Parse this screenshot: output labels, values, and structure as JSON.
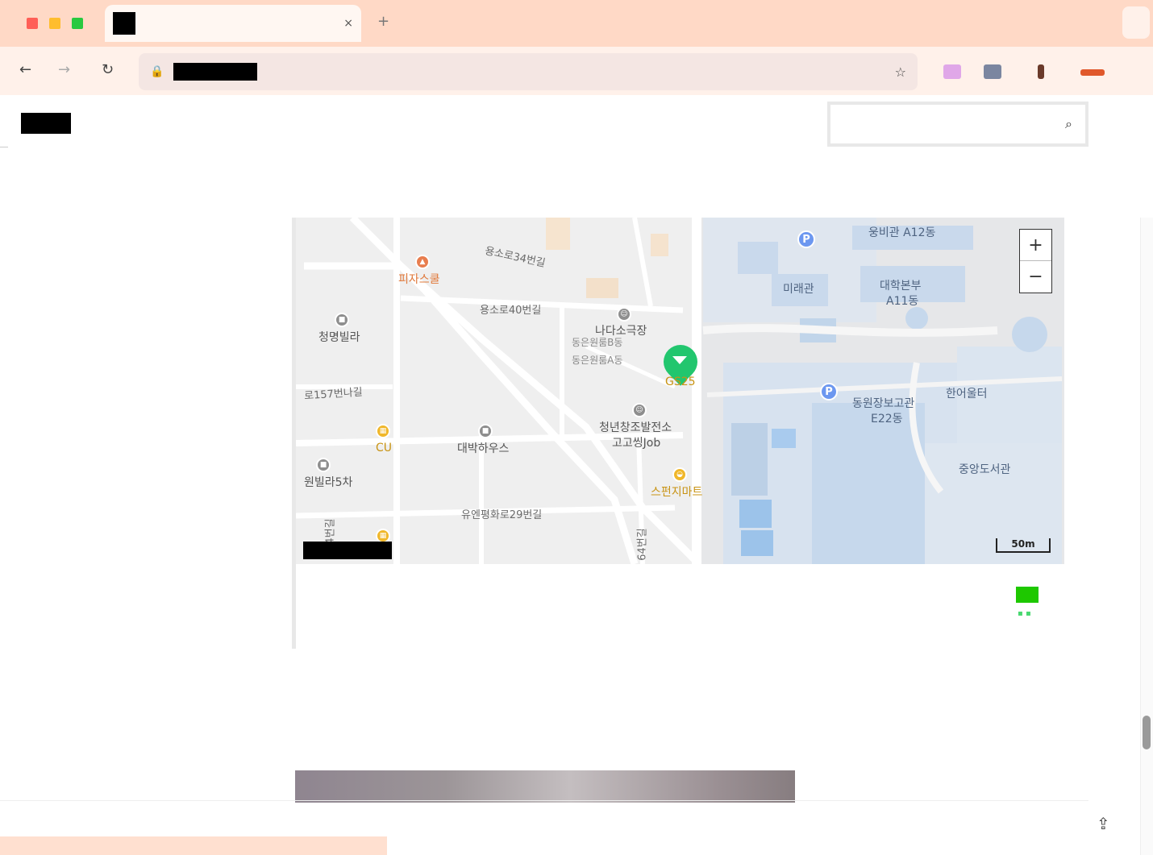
{
  "browser": {
    "tab_title": "",
    "tab_close": "×",
    "new_tab": "+",
    "url": "",
    "colors": {
      "tabbar_bg": "#ffd9c6",
      "toolbar_bg": "#fff1ea",
      "red": "#ff5f57",
      "yellow": "#ffbd2e",
      "green": "#28c940"
    }
  },
  "page": {
    "site_title": "",
    "search_placeholder": "",
    "section_label": "",
    "source_label": "",
    "source_link": "",
    "bottom_text": "",
    "status_text": ""
  },
  "map": {
    "zoom_in": "+",
    "zoom_out": "−",
    "scale": "50m",
    "roads": {
      "r1": "용소로34번길",
      "r2": "용소로40번길",
      "r3": "로157번나길",
      "r4": "유엔평화로29번길",
      "r5": "4번길",
      "r6": "64번길"
    },
    "pois": {
      "pizza": "피자스쿨",
      "cheongmyeong": "청명빌라",
      "nada": "나다소극장",
      "dongeun_b": "동은원룸B동",
      "dongeun_a": "동은원룸A동",
      "gs25": "GS25",
      "youth": "청년창조발전소",
      "gogossing": "고고씽Job",
      "daebak": "대박하우스",
      "cu": "CU",
      "villa5": "원빌라5차",
      "spend": "스펀지마트"
    },
    "campus": {
      "ungbi": "웅비관 A12동",
      "mirae": "미래관",
      "hq": "대학본부",
      "hq_code": "A11동",
      "dongwon": "동원장보고관",
      "dongwon_code": "E22동",
      "haneo": "한어울터",
      "library": "중앙도서관"
    },
    "parking": "P"
  },
  "place_card": {
    "name": "",
    "address": ""
  }
}
